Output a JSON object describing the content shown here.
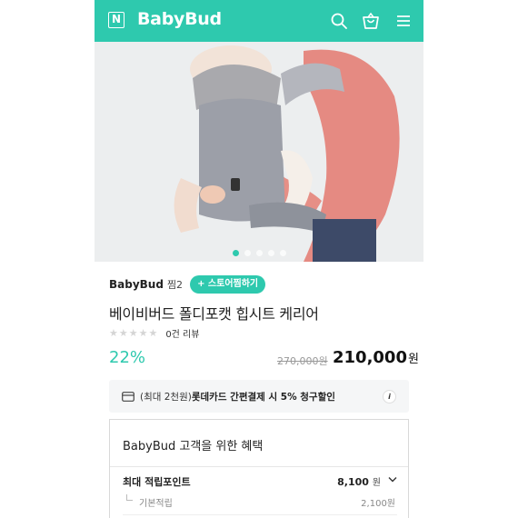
{
  "header": {
    "logo_letter": "N",
    "brand": "BabyBud",
    "icons": [
      "search-icon",
      "shopping-bag-icon",
      "menu-icon"
    ],
    "color": "#2ec9ae"
  },
  "hero": {
    "image_alt": "baby carrier product photo",
    "slide_count": 5,
    "active_slide": 1
  },
  "store": {
    "name": "BabyBud",
    "jjim": "찜2",
    "button_label": "+ 스토어찜하기"
  },
  "product": {
    "title": "베이비버드 폴디포캣 힙시트 케리어",
    "stars": "★★★★★",
    "review_count": "0건 리뷰",
    "discount": "22%",
    "original_price": "270,000원",
    "price": "210,000",
    "price_unit": "원"
  },
  "card_promo": {
    "prefix": "(최대 2천원)",
    "text": "롯데카드 간편결제 시 5% 청구할인",
    "info": "i"
  },
  "benefit": {
    "title": "BabyBud 고객을 위한 혜택",
    "points_label": "최대 적립포인트",
    "points_value": "8,100",
    "points_unit": "원",
    "basic_label": "기본적립",
    "basic_value": "2,100원"
  }
}
